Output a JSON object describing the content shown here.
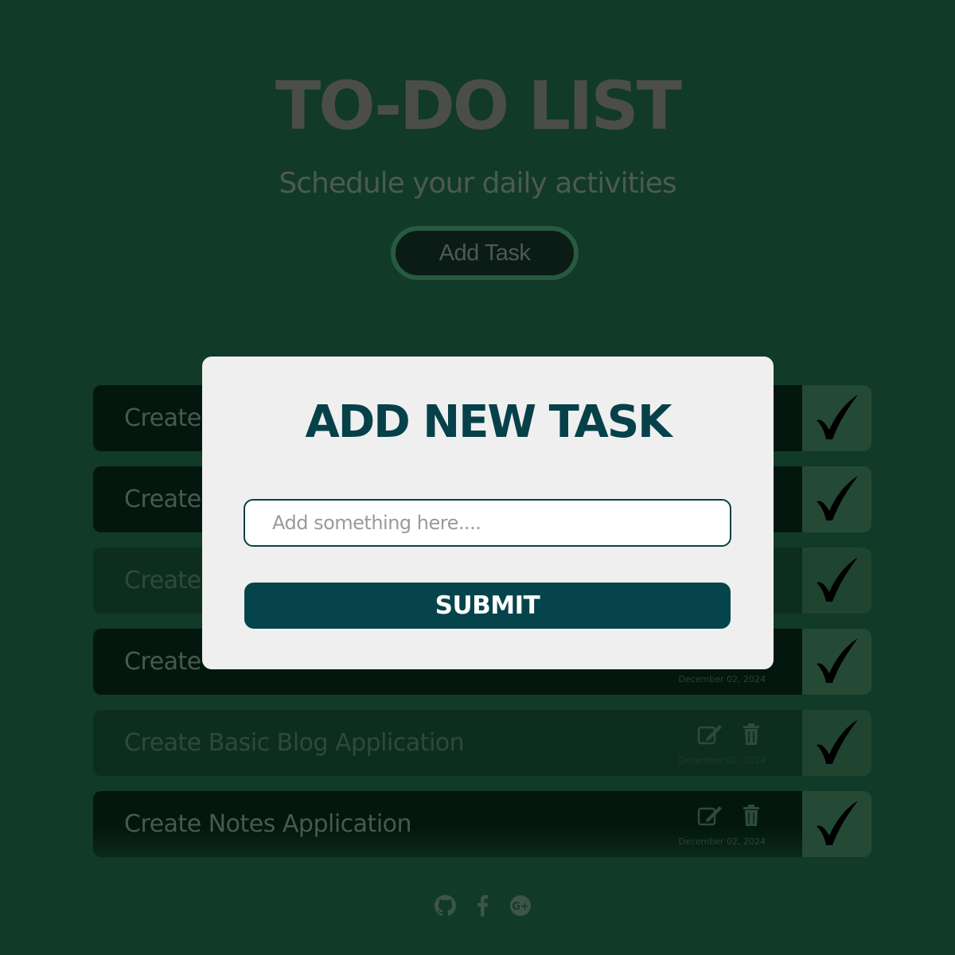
{
  "header": {
    "title": "TO-DO LIST",
    "subtitle": "Schedule your daily activities",
    "add_task_label": "Add Task"
  },
  "tasks": [
    {
      "title": "Create",
      "date": "",
      "style": "dark",
      "has_actions": false
    },
    {
      "title": "Create",
      "date": "",
      "style": "dark",
      "has_actions": false
    },
    {
      "title": "Create",
      "date": "",
      "style": "light",
      "has_actions": false
    },
    {
      "title": "Create",
      "date": "December 02, 2024",
      "style": "dark",
      "has_actions": false
    },
    {
      "title": "Create Basic Blog Application",
      "date": "December 02, 2024",
      "style": "light",
      "has_actions": true
    },
    {
      "title": "Create Notes Application",
      "date": "December 02, 2024",
      "style": "last",
      "has_actions": true
    }
  ],
  "social": [
    "github-icon",
    "facebook-icon",
    "google-plus-icon"
  ],
  "modal": {
    "title": "ADD NEW TASK",
    "input_placeholder": "Add something here....",
    "input_value": "",
    "submit_label": "SUBMIT"
  },
  "colors": {
    "background": "#113a28",
    "modal_background": "#efefef",
    "accent": "#06444b",
    "check_box": "#244a35"
  }
}
